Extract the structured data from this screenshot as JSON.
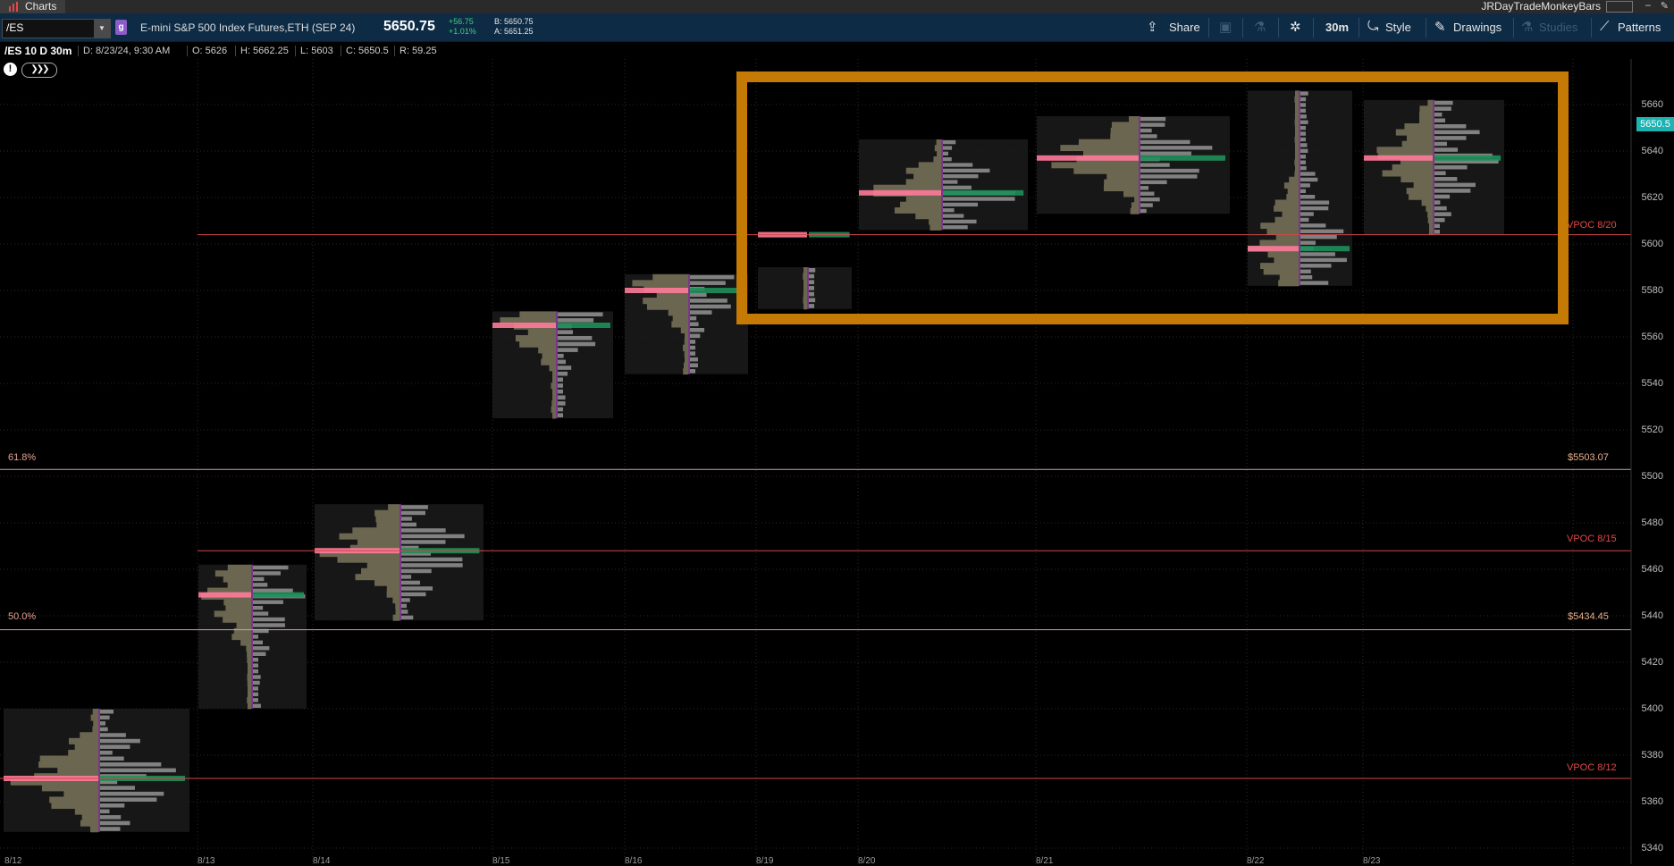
{
  "window": {
    "app_tab": "Charts",
    "user": "JRDayTradeMonkeyBars",
    "minimize_glyph": "–",
    "pin_glyph": "✎"
  },
  "toolbar": {
    "symbol": "/ES",
    "dropdown_glyph": "▼",
    "group_badge": "g",
    "description": "E-mini S&P 500 Index Futures,ETH (SEP 24)",
    "last": "5650.75",
    "change": "+56.75",
    "change_pct": "+1.01%",
    "bid": "B: 5650.75",
    "ask": "A: 5651.25",
    "share": "Share",
    "share_icon": "⇪",
    "chat_icon": "▣",
    "flask_icon": "⚗",
    "gear_icon": "✲",
    "timeframe": "30m",
    "style": "Style",
    "style_icon": "⤿",
    "drawings": "Drawings",
    "drawings_icon": "✎",
    "studies": "Studies",
    "studies_icon": "⚗",
    "patterns": "Patterns",
    "patterns_icon": "⟋"
  },
  "info": {
    "title": "/ES 10 D 30m",
    "date": "D: 8/23/24, 9:30 AM",
    "open": "O: 5626",
    "high": "H: 5662.25",
    "low": "L: 5603",
    "close": "C: 5650.5",
    "range": "R: 59.25",
    "alert_icon": "!",
    "nav_arrows": "❯❯❯"
  },
  "chart": {
    "y_labels": [
      "5660",
      "5640",
      "5620",
      "5600",
      "5580",
      "5560",
      "5540",
      "5520",
      "5500",
      "5480",
      "5460",
      "5440",
      "5420",
      "5400",
      "5380",
      "5360",
      "5340"
    ],
    "current_price_tag": "5650.5",
    "levels": {
      "fib_618_left": "61.8%",
      "fib_618_right": "$5503.07",
      "fib_50_left": "50.0%",
      "fib_50_right": "$5434.45",
      "vpoc_820": "VPOC 8/20",
      "vpoc_815": "VPOC 8/15",
      "vpoc_812": "VPOC 8/12"
    },
    "colors": {
      "highlight_box": "#c67a06",
      "vpoc_line": "#d04848",
      "fib_line": "#c9a59c",
      "profile": "#6b6650",
      "poc_bar": "#ff7a9a",
      "tpo_value_area": "#1e8f5a"
    },
    "date_labels": [
      "8/12",
      "8/13",
      "8/14",
      "8/15",
      "8/16",
      "8/19",
      "8/20",
      "8/21",
      "8/22",
      "8/23"
    ]
  }
}
